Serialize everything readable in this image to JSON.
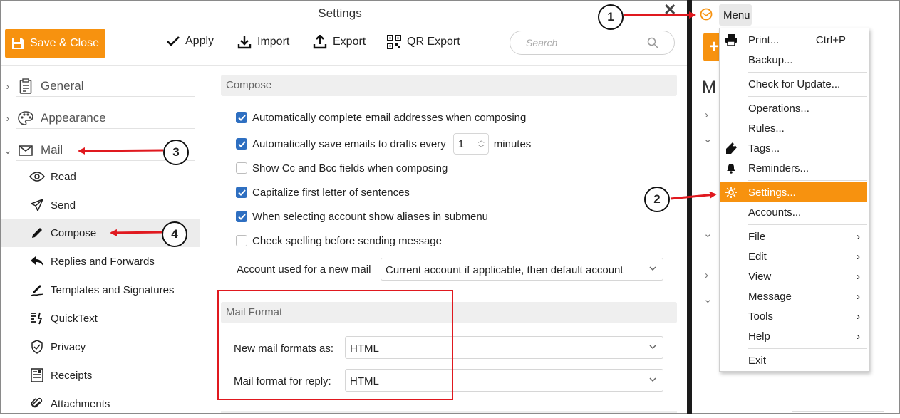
{
  "settings": {
    "title": "Settings",
    "close": "✕",
    "toolbar": {
      "save_close": "Save & Close",
      "apply": "Apply",
      "import": "Import",
      "export": "Export",
      "qr_export": "QR Export",
      "search_placeholder": "Search"
    },
    "nav": {
      "top": [
        {
          "label": "General",
          "expanded": false
        },
        {
          "label": "Appearance",
          "expanded": false
        },
        {
          "label": "Mail",
          "expanded": true
        }
      ],
      "mail_items": [
        "Read",
        "Send",
        "Compose",
        "Replies and Forwards",
        "Templates and Signatures",
        "QuickText",
        "Privacy",
        "Receipts",
        "Attachments"
      ],
      "selected": "Compose"
    },
    "compose": {
      "header": "Compose",
      "options": [
        {
          "label": "Automatically complete email addresses when composing",
          "checked": true
        },
        {
          "label": "Automatically save emails to drafts every",
          "checked": true,
          "value": "1",
          "suffix": "minutes"
        },
        {
          "label": "Show Cc and Bcc fields when composing",
          "checked": false
        },
        {
          "label": "Capitalize first letter of sentences",
          "checked": true
        },
        {
          "label": "When selecting account show aliases in submenu",
          "checked": true
        },
        {
          "label": "Check spelling before sending message",
          "checked": false
        }
      ],
      "account_label": "Account used for a new mail",
      "account_value": "Current account if applicable, then default account"
    },
    "mail_format": {
      "header": "Mail Format",
      "new_label": "New mail formats as:",
      "new_value": "HTML",
      "reply_label": "Mail format for reply:",
      "reply_value": "HTML"
    }
  },
  "app": {
    "menu_button": "Menu",
    "partial_letter": "M",
    "menu_items": [
      {
        "label": "Print...",
        "shortcut": "Ctrl+P",
        "icon": "printer-icon"
      },
      {
        "label": "Backup..."
      },
      {
        "label": "Check for Update..."
      },
      {
        "label": "Operations..."
      },
      {
        "label": "Rules..."
      },
      {
        "label": "Tags...",
        "icon": "tag-icon"
      },
      {
        "label": "Reminders...",
        "icon": "bell-icon"
      },
      {
        "label": "Settings...",
        "icon": "gear-icon",
        "highlighted": true
      },
      {
        "label": "Accounts..."
      },
      {
        "label": "File",
        "submenu": true
      },
      {
        "label": "Edit",
        "submenu": true
      },
      {
        "label": "View",
        "submenu": true
      },
      {
        "label": "Message",
        "submenu": true
      },
      {
        "label": "Tools",
        "submenu": true
      },
      {
        "label": "Help",
        "submenu": true
      },
      {
        "label": "Exit"
      }
    ]
  },
  "annotations": [
    "1",
    "2",
    "3",
    "4"
  ],
  "colors": {
    "accent": "#f7920f",
    "checkbox": "#2e6fc1",
    "arrow": "#e0191f",
    "highlight_box": "#e0191f"
  }
}
